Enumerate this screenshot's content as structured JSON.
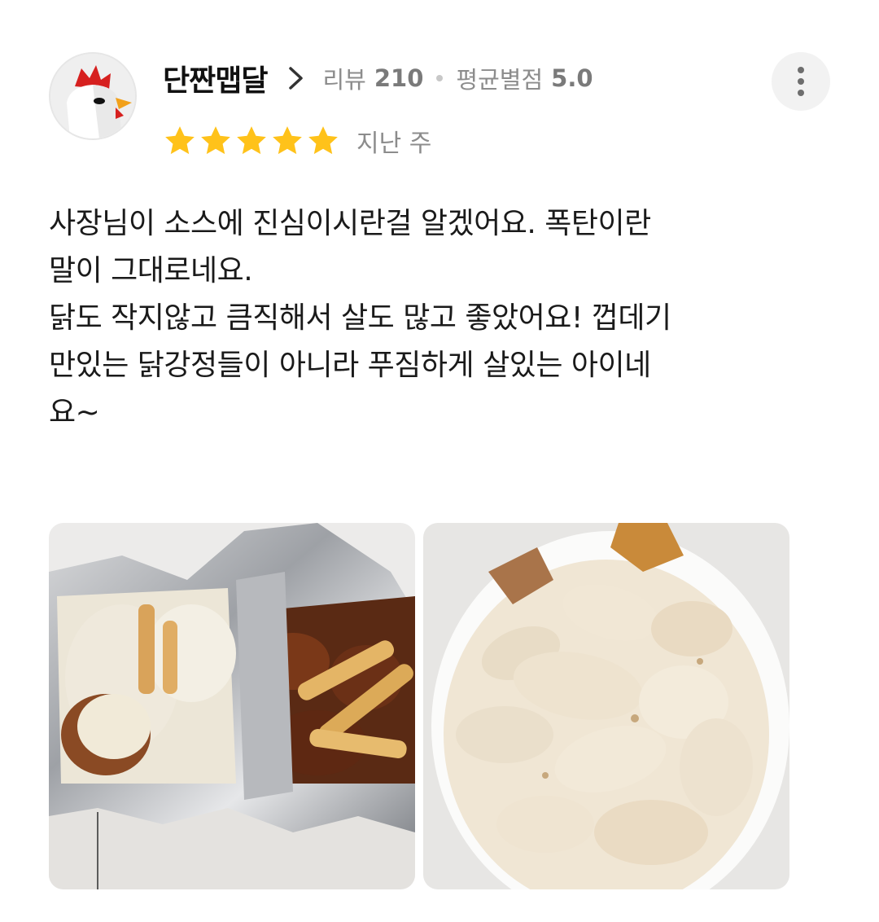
{
  "review": {
    "author": {
      "nickname": "단짠맵달",
      "review_label": "리뷰",
      "review_count": "210",
      "avg_label": "평균별점",
      "avg_rating": "5.0"
    },
    "rating": 5,
    "time_ago": "지난 주",
    "text": "사장님이 소스에 진심이시란걸 알겠어요. 폭탄이란\n말이 그대로네요.\n닭도 작지않고 큼직해서 살도 많고 좋았어요! 껍데기\n만있는 닭강정들이 아니라 푸짐하게 살있는 아이네\n요~",
    "photos": [
      "food-photo-sauced-chicken",
      "food-photo-powdered-chicken"
    ]
  },
  "colors": {
    "star": "#FFC21A",
    "meta_text": "#8c8c8c",
    "more_bg": "#f2f2f2"
  },
  "icons": {
    "more": "kebab-vertical-icon",
    "chevron": "chevron-right-icon",
    "avatar": "chicken-mascot-avatar"
  }
}
